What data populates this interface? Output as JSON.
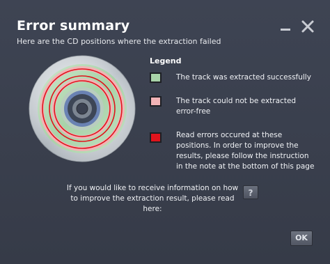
{
  "dialog": {
    "title": "Error summary",
    "subtitle": "Here are the CD positions where the extraction failed"
  },
  "window_controls": {
    "minimize_icon": "minimize-icon",
    "close_icon": "close-icon"
  },
  "legend": {
    "title": "Legend",
    "items": [
      {
        "label": "The track was extracted successfully",
        "color": "#a8d3a8"
      },
      {
        "label": "The track could not be extracted error-free",
        "color": "#f1b3b6"
      },
      {
        "label": "Read errors occured at these positions.  In order to improve the results, please follow the instruction in the note at the bottom of this page",
        "color": "#e0141c"
      }
    ]
  },
  "info": {
    "text": "If you would like to receive information on how to improve the extraction result, please read here:",
    "help_label": "?"
  },
  "footer": {
    "ok_label": "OK"
  },
  "colors": {
    "background": "#3b4150",
    "success": "#a8d3a8",
    "not_error_free": "#f1b3b6",
    "read_error": "#e0141c",
    "disc_hub": "#5f7fb4"
  }
}
